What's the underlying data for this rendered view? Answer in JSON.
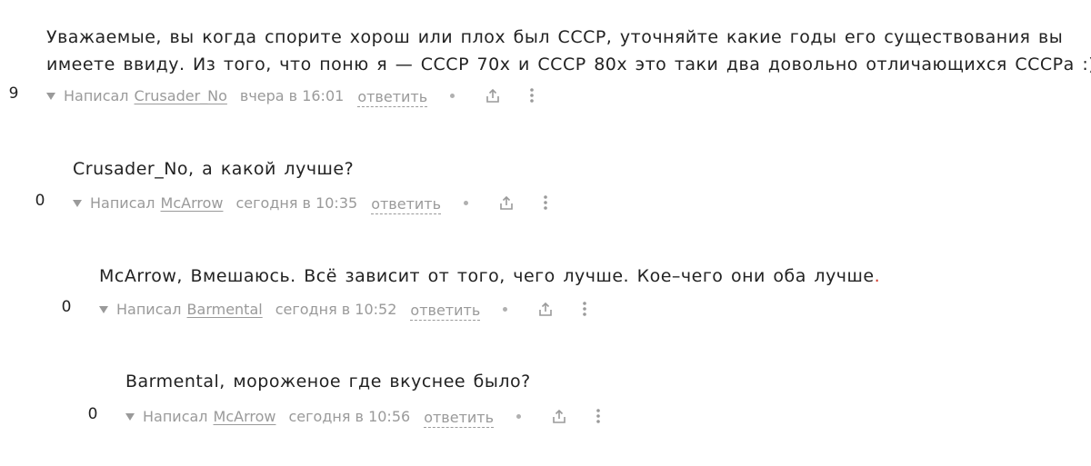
{
  "comments": [
    {
      "text_line1": "Уважаемые, вы когда спорите хорош или плох был СССР, уточняйте какие годы его существования вы",
      "text_line2": "имеете ввиду. Из того, что поню я — СССР 70х и СССР 80х это таки два довольно отличающихся СССРа :)",
      "score": "9",
      "written_label": "Написал",
      "author": "Crusader_No",
      "time": "вчера в 16:01",
      "reply_label": "ответить"
    },
    {
      "text_line1": "Crusader_No, а какой лучше?",
      "score": "0",
      "written_label": "Написал",
      "author": "McArrow",
      "time": "сегодня в 10:35",
      "reply_label": "ответить"
    },
    {
      "text_main": "McArrow, Вмешаюсь. Всё зависит от того, чего лучше. Кое–чего они оба лучше",
      "text_tail": ".",
      "score": "0",
      "written_label": "Написал",
      "author": "Barmental",
      "time": "сегодня в 10:52",
      "reply_label": "ответить"
    },
    {
      "text_line1": "Barmental, мороженое где вкуснее было?",
      "score": "0",
      "written_label": "Написал",
      "author": "McArrow",
      "time": "сегодня в 10:56",
      "reply_label": "ответить"
    }
  ],
  "icons": {
    "expand": "triangle-down-icon",
    "separator": "dot-icon",
    "share": "share-icon",
    "more": "more-vertical-icon"
  },
  "colors": {
    "text": "#222222",
    "meta": "#9a9a9a",
    "accent": "#d23a2c"
  }
}
